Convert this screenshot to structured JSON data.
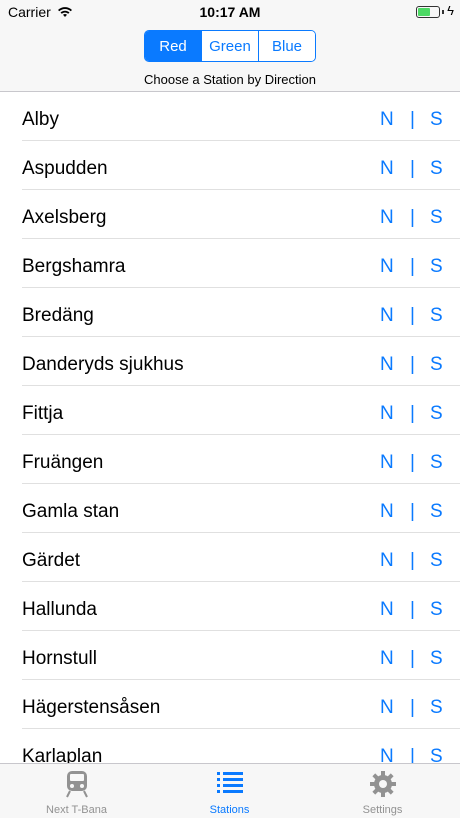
{
  "status_bar": {
    "carrier": "Carrier",
    "time": "10:17 AM",
    "battery_level": 0.6
  },
  "header": {
    "segments": [
      "Red",
      "Green",
      "Blue"
    ],
    "selected_segment": "Red",
    "subtitle": "Choose a Station by Direction"
  },
  "stations": [
    {
      "name": "Alby",
      "north": "N",
      "sep": "|",
      "south": "S"
    },
    {
      "name": "Aspudden",
      "north": "N",
      "sep": "|",
      "south": "S"
    },
    {
      "name": "Axelsberg",
      "north": "N",
      "sep": "|",
      "south": "S"
    },
    {
      "name": "Bergshamra",
      "north": "N",
      "sep": "|",
      "south": "S"
    },
    {
      "name": "Bredäng",
      "north": "N",
      "sep": "|",
      "south": "S"
    },
    {
      "name": "Danderyds sjukhus",
      "north": "N",
      "sep": "|",
      "south": "S"
    },
    {
      "name": "Fittja",
      "north": "N",
      "sep": "|",
      "south": "S"
    },
    {
      "name": "Fruängen",
      "north": "N",
      "sep": "|",
      "south": "S"
    },
    {
      "name": "Gamla stan",
      "north": "N",
      "sep": "|",
      "south": "S"
    },
    {
      "name": "Gärdet",
      "north": "N",
      "sep": "|",
      "south": "S"
    },
    {
      "name": "Hallunda",
      "north": "N",
      "sep": "|",
      "south": "S"
    },
    {
      "name": "Hornstull",
      "north": "N",
      "sep": "|",
      "south": "S"
    },
    {
      "name": "Hägerstensåsen",
      "north": "N",
      "sep": "|",
      "south": "S"
    },
    {
      "name": "Karlaplan",
      "north": "N",
      "sep": "|",
      "south": "S"
    }
  ],
  "tab_bar": {
    "tabs": [
      {
        "label": "Next T-Bana",
        "icon": "train-icon"
      },
      {
        "label": "Stations",
        "icon": "list-icon"
      },
      {
        "label": "Settings",
        "icon": "gear-icon"
      }
    ],
    "active_tab": "Stations"
  },
  "colors": {
    "accent": "#0a7aff",
    "inactive": "#929292",
    "battery": "#4cd964"
  }
}
